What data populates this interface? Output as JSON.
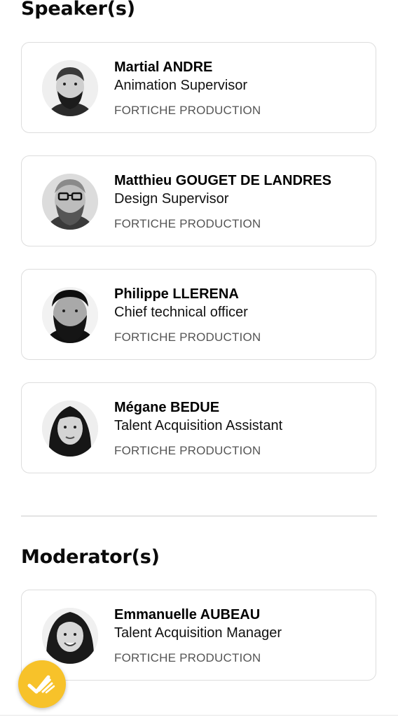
{
  "speakers_section": {
    "title": "Speaker(s)"
  },
  "speakers": [
    {
      "name": "Martial ANDRE",
      "role": "Animation Supervisor",
      "company": "FORTICHE PRODUCTION"
    },
    {
      "name": "Matthieu GOUGET DE LANDRES",
      "role": "Design Supervisor",
      "company": "FORTICHE PRODUCTION"
    },
    {
      "name": "Philippe LLERENA",
      "role": "Chief technical officer",
      "company": "FORTICHE PRODUCTION"
    },
    {
      "name": "Mégane BEDUE",
      "role": "Talent Acquisition Assistant",
      "company": "FORTICHE PRODUCTION"
    }
  ],
  "moderators_section": {
    "title": "Moderator(s)"
  },
  "moderators": [
    {
      "name": "Emmanuelle AUBEAU",
      "role": "Talent Acquisition Manager",
      "company": "FORTICHE PRODUCTION"
    }
  ],
  "fab": {
    "icon": "clap-hand-icon",
    "color": "#f7c22a"
  }
}
